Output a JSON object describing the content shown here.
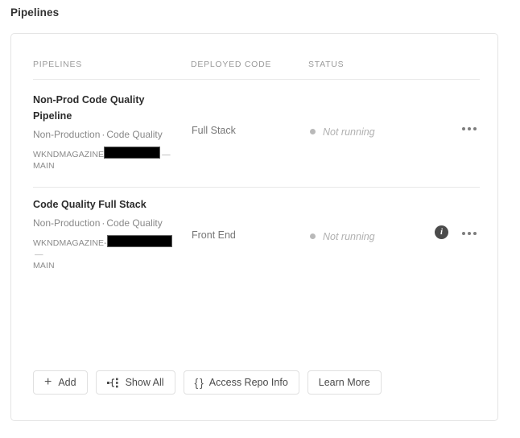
{
  "page": {
    "title": "Pipelines"
  },
  "table": {
    "columns": [
      {
        "label": "PIPELINES"
      },
      {
        "label": "DEPLOYED CODE"
      },
      {
        "label": "STATUS"
      }
    ],
    "rows": [
      {
        "name": "Non-Prod Code Quality Pipeline",
        "environment": "Non-Production",
        "separator": "·",
        "kind": "Code Quality",
        "repo_prefix": "WKNDMAGAZINE",
        "repo_redacted": true,
        "repo_dash": "—",
        "repo_branch": "MAIN",
        "deployed_code": "Full Stack",
        "status": "Not running",
        "status_color": "#b9b9b9",
        "has_info_icon": false,
        "has_more_icon": true
      },
      {
        "name": "Code Quality Full Stack",
        "environment": "Non-Production",
        "separator": "·",
        "kind": "Code Quality",
        "repo_prefix": "WKNDMAGAZINE-",
        "repo_redacted": true,
        "repo_dash": "—",
        "repo_branch": "MAIN",
        "deployed_code": "Front End",
        "status": "Not running",
        "status_color": "#b9b9b9",
        "has_info_icon": true,
        "has_more_icon": true
      }
    ]
  },
  "footer": {
    "buttons": [
      {
        "label": "Add",
        "icon": "plus-icon"
      },
      {
        "label": "Show All",
        "icon": "hierarchy-icon"
      },
      {
        "label": "Access Repo Info",
        "icon": "braces-icon"
      },
      {
        "label": "Learn More",
        "icon": null
      }
    ]
  },
  "icons": {
    "plus": "+",
    "braces": "{ }",
    "info": "i"
  }
}
